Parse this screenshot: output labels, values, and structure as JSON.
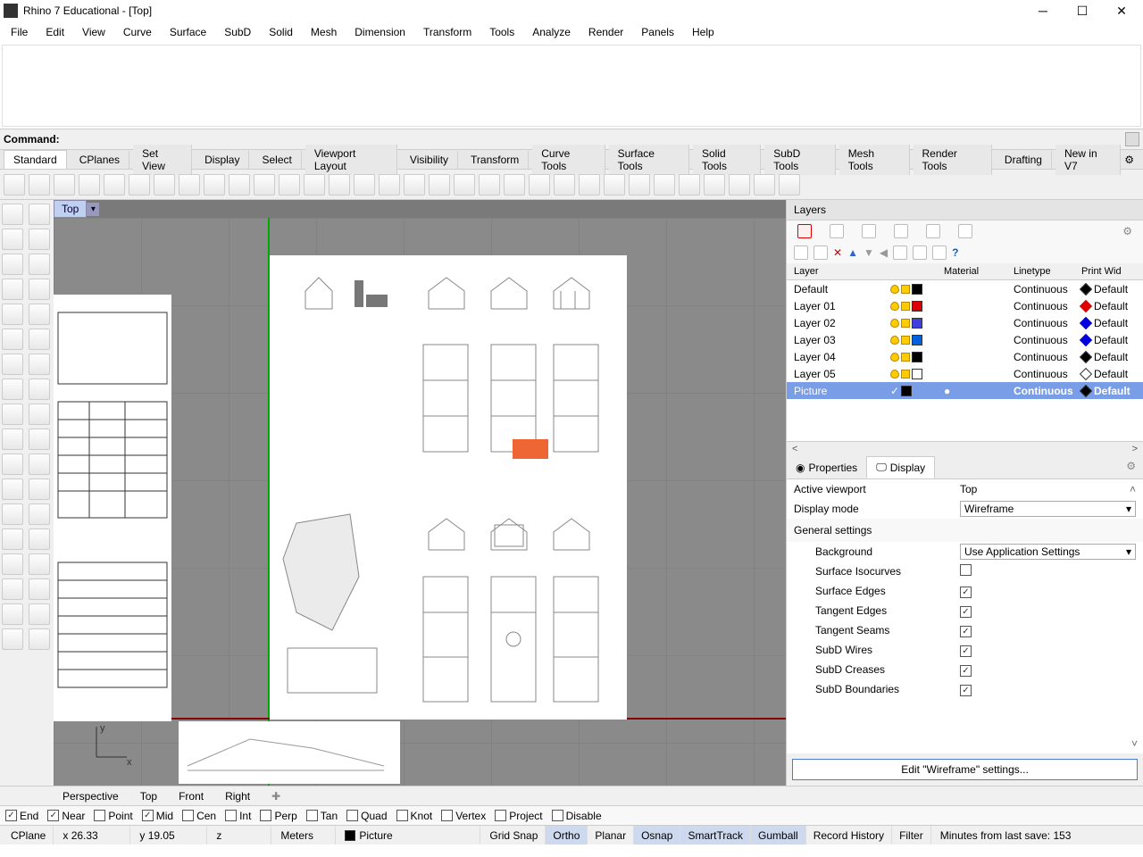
{
  "window": {
    "title": "Rhino 7 Educational - [Top]"
  },
  "menu": [
    "File",
    "Edit",
    "View",
    "Curve",
    "Surface",
    "SubD",
    "Solid",
    "Mesh",
    "Dimension",
    "Transform",
    "Tools",
    "Analyze",
    "Render",
    "Panels",
    "Help"
  ],
  "command": {
    "label": "Command:",
    "value": ""
  },
  "toolbar_tabs": [
    "Standard",
    "CPlanes",
    "Set View",
    "Display",
    "Select",
    "Viewport Layout",
    "Visibility",
    "Transform",
    "Curve Tools",
    "Surface Tools",
    "Solid Tools",
    "SubD Tools",
    "Mesh Tools",
    "Render Tools",
    "Drafting",
    "New in V7"
  ],
  "viewport": {
    "label": "Top"
  },
  "view_tabs": [
    "Perspective",
    "Top",
    "Front",
    "Right"
  ],
  "layers_panel": {
    "title": "Layers",
    "columns": {
      "layer": "Layer",
      "material": "Material",
      "linetype": "Linetype",
      "printwid": "Print Wid"
    },
    "rows": [
      {
        "name": "Default",
        "color": "#000000",
        "linetype": "Continuous",
        "print": "Default",
        "diamond": "black",
        "selected": false,
        "material": ""
      },
      {
        "name": "Layer 01",
        "color": "#dd0000",
        "linetype": "Continuous",
        "print": "Default",
        "diamond": "red",
        "selected": false,
        "material": ""
      },
      {
        "name": "Layer 02",
        "color": "#4040dd",
        "linetype": "Continuous",
        "print": "Default",
        "diamond": "blue",
        "selected": false,
        "material": ""
      },
      {
        "name": "Layer 03",
        "color": "#0060dd",
        "linetype": "Continuous",
        "print": "Default",
        "diamond": "blue",
        "selected": false,
        "material": ""
      },
      {
        "name": "Layer 04",
        "color": "#000000",
        "linetype": "Continuous",
        "print": "Default",
        "diamond": "black",
        "selected": false,
        "material": ""
      },
      {
        "name": "Layer 05",
        "color": "#ffffff",
        "linetype": "Continuous",
        "print": "Default",
        "diamond": "white",
        "selected": false,
        "material": ""
      },
      {
        "name": "Picture",
        "color": "#000000",
        "linetype": "Continuous",
        "print": "Default",
        "diamond": "black",
        "selected": true,
        "material": "●"
      }
    ]
  },
  "props_tabs": {
    "properties": "Properties",
    "display": "Display"
  },
  "display_panel": {
    "active_viewport": {
      "label": "Active viewport",
      "value": "Top"
    },
    "display_mode": {
      "label": "Display mode",
      "value": "Wireframe"
    },
    "general": {
      "header": "General settings"
    },
    "background": {
      "label": "Background",
      "value": "Use Application Settings"
    },
    "checks": [
      {
        "label": "Surface Isocurves",
        "checked": false
      },
      {
        "label": "Surface Edges",
        "checked": true
      },
      {
        "label": "Tangent Edges",
        "checked": true
      },
      {
        "label": "Tangent Seams",
        "checked": true
      },
      {
        "label": "SubD Wires",
        "checked": true
      },
      {
        "label": "SubD Creases",
        "checked": true
      },
      {
        "label": "SubD Boundaries",
        "checked": true
      }
    ],
    "edit_button": "Edit \"Wireframe\" settings..."
  },
  "osnap": [
    {
      "label": "End",
      "checked": true
    },
    {
      "label": "Near",
      "checked": true
    },
    {
      "label": "Point",
      "checked": false
    },
    {
      "label": "Mid",
      "checked": true
    },
    {
      "label": "Cen",
      "checked": false
    },
    {
      "label": "Int",
      "checked": false
    },
    {
      "label": "Perp",
      "checked": false
    },
    {
      "label": "Tan",
      "checked": false
    },
    {
      "label": "Quad",
      "checked": false
    },
    {
      "label": "Knot",
      "checked": false
    },
    {
      "label": "Vertex",
      "checked": false
    },
    {
      "label": "Project",
      "checked": false
    },
    {
      "label": "Disable",
      "checked": false
    }
  ],
  "status": {
    "cplane": "CPlane",
    "x": "x 26.33",
    "y": "y 19.05",
    "z": "z",
    "units": "Meters",
    "layer": "Picture",
    "toggles": [
      {
        "label": "Grid Snap",
        "on": false
      },
      {
        "label": "Ortho",
        "on": true
      },
      {
        "label": "Planar",
        "on": false
      },
      {
        "label": "Osnap",
        "on": true
      },
      {
        "label": "SmartTrack",
        "on": true
      },
      {
        "label": "Gumball",
        "on": true
      },
      {
        "label": "Record History",
        "on": false
      },
      {
        "label": "Filter",
        "on": false
      }
    ],
    "save_time": "Minutes from last save: 153"
  }
}
